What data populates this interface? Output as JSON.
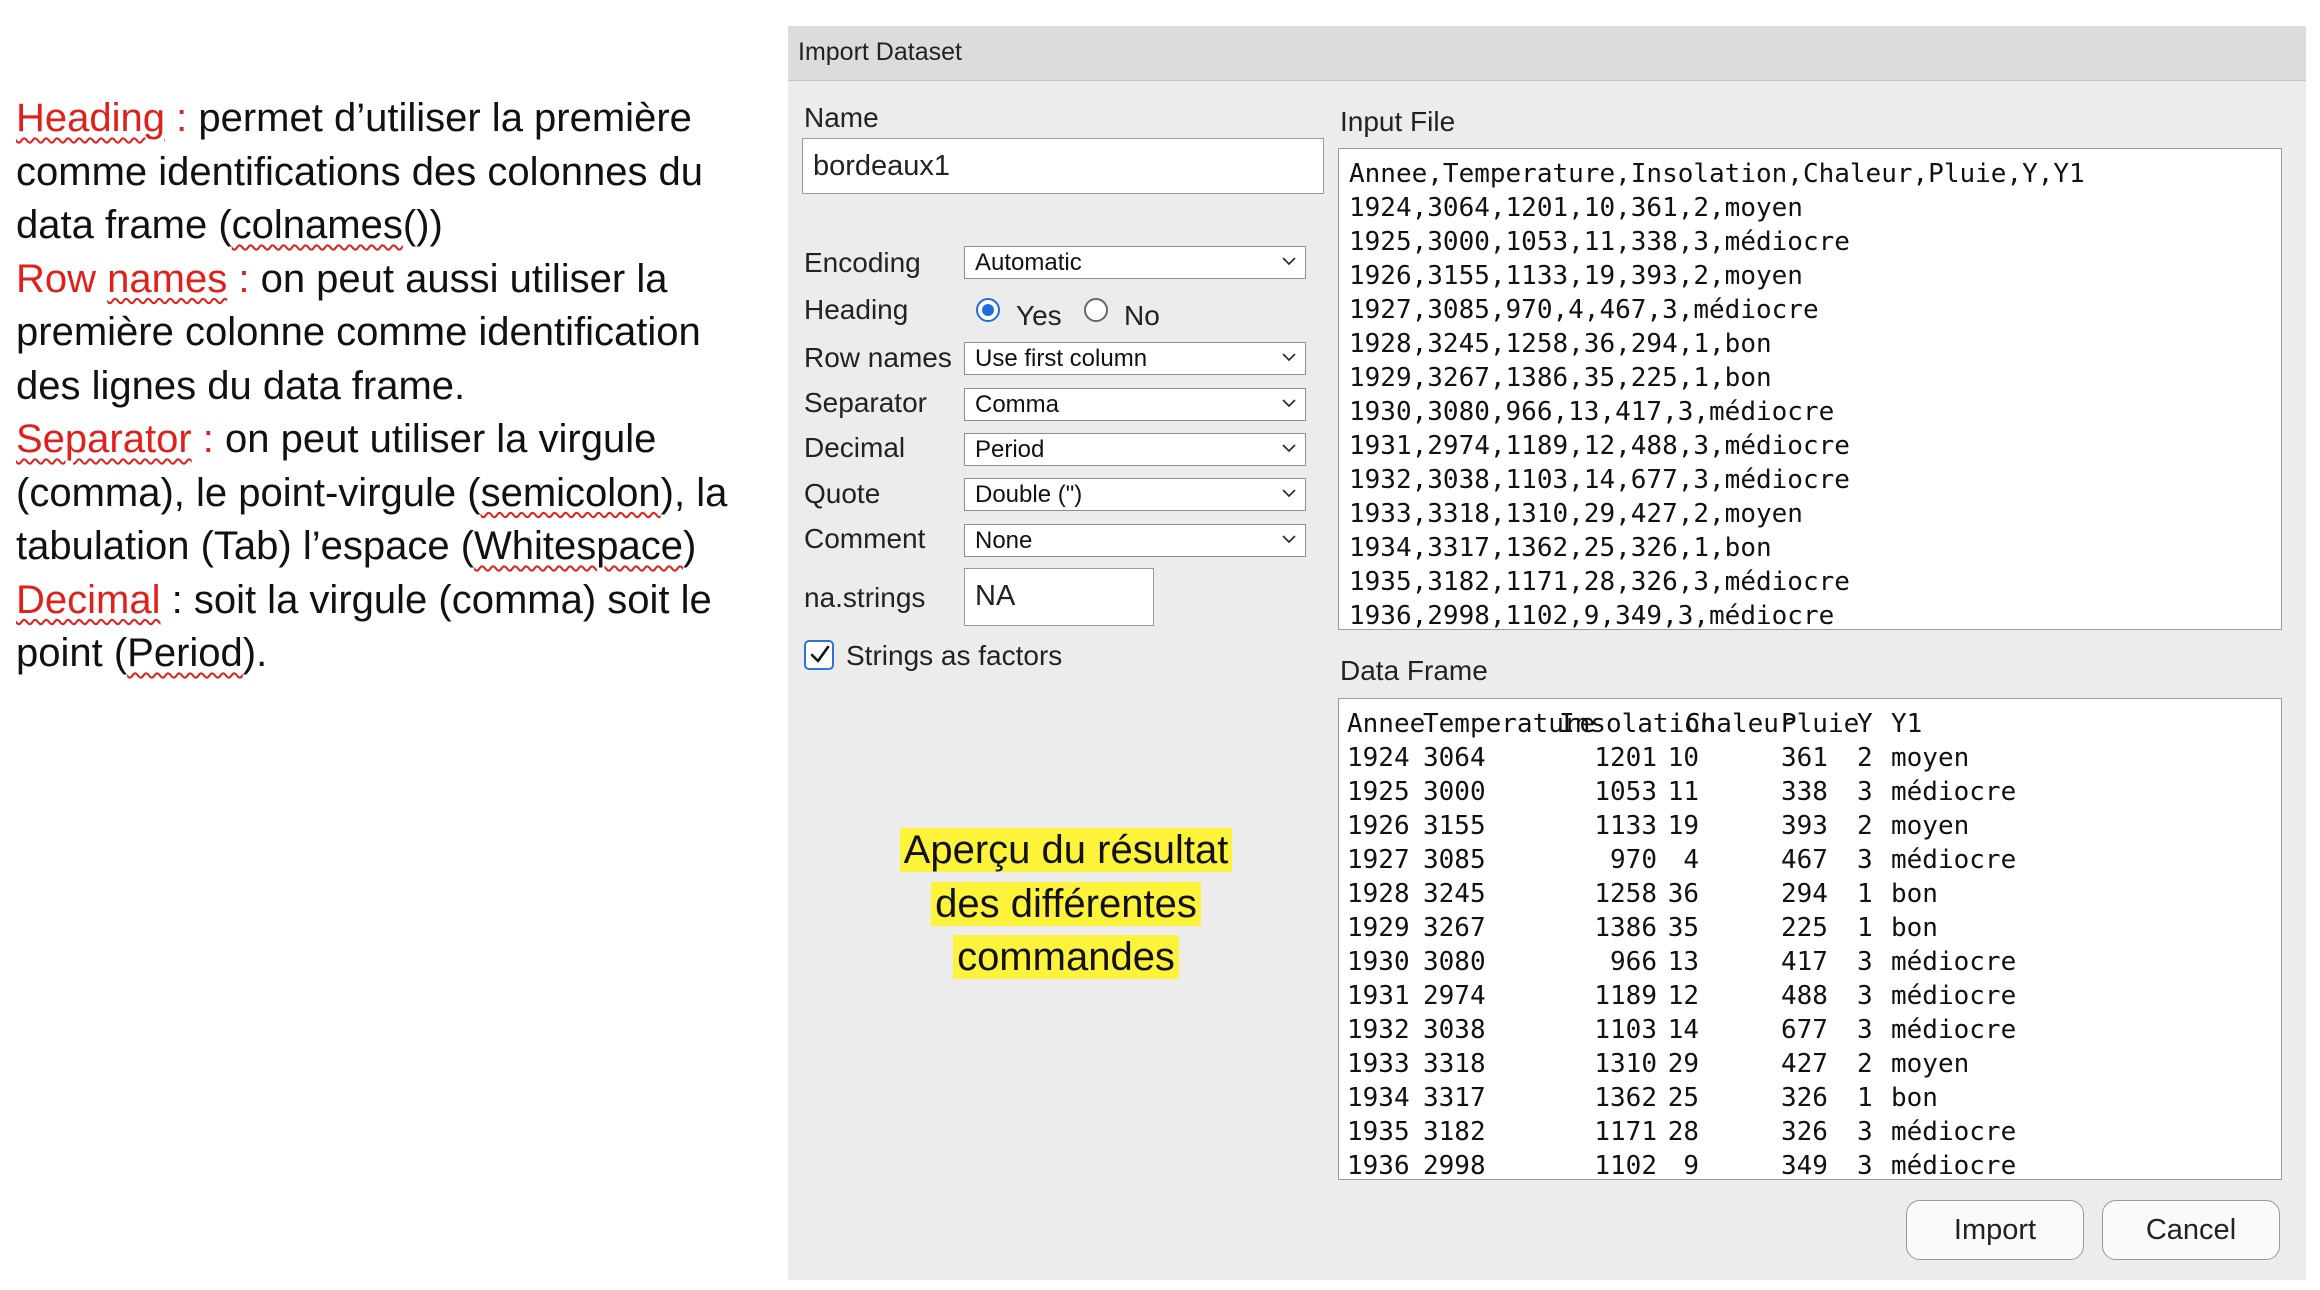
{
  "notes": {
    "p1": {
      "label": "Heading",
      "colon": " :",
      "text1": " permet d’utiliser la première comme identifications des colonnes du data frame (",
      "code": "colnames",
      "text2": "())"
    },
    "p2": {
      "label1": "Row",
      "label2": "names",
      "colon": " :",
      "text": " on peut aussi utiliser la première colonne comme identification des lignes du data frame."
    },
    "p3": {
      "label": "Separator",
      "colon": " :",
      "text1": " on peut utiliser la virgule (comma), le point-virgule (",
      "w1": "semicolon",
      "text2": "), la tabulation (Tab) l’espace (",
      "w2": "Whitespace",
      "text3": ")"
    },
    "p4": {
      "label": "Decimal",
      "text1": " : soit la virgule (comma) soit le point (",
      "w1": "Period",
      "text2": ")."
    }
  },
  "dialog": {
    "title": "Import Dataset",
    "name_label": "Name",
    "name_value": "bordeaux1",
    "encoding": {
      "label": "Encoding",
      "value": "Automatic"
    },
    "heading": {
      "label": "Heading",
      "yes": "Yes",
      "no": "No",
      "selected": "Yes"
    },
    "row_names": {
      "label": "Row names",
      "value": "Use first column"
    },
    "separator": {
      "label": "Separator",
      "value": "Comma"
    },
    "decimal": {
      "label": "Decimal",
      "value": "Period"
    },
    "quote": {
      "label": "Quote",
      "value": "Double (\")"
    },
    "comment": {
      "label": "Comment",
      "value": "None"
    },
    "na_strings": {
      "label": "na.strings",
      "value": "NA"
    },
    "strings_as_factors": {
      "label": "Strings as factors",
      "checked": true
    },
    "highlight": [
      "Aperçu du résultat",
      "des différentes",
      "commandes"
    ],
    "input_file": {
      "label": "Input File",
      "lines": [
        "Annee,Temperature,Insolation,Chaleur,Pluie,Y,Y1",
        "1924,3064,1201,10,361,2,moyen",
        "1925,3000,1053,11,338,3,médiocre",
        "1926,3155,1133,19,393,2,moyen",
        "1927,3085,970,4,467,3,médiocre",
        "1928,3245,1258,36,294,1,bon",
        "1929,3267,1386,35,225,1,bon",
        "1930,3080,966,13,417,3,médiocre",
        "1931,2974,1189,12,488,3,médiocre",
        "1932,3038,1103,14,677,3,médiocre",
        "1933,3318,1310,29,427,2,moyen",
        "1934,3317,1362,25,326,1,bon",
        "1935,3182,1171,28,326,3,médiocre",
        "1936,2998,1102,9,349,3,médiocre"
      ]
    },
    "data_frame": {
      "label": "Data Frame",
      "columns": [
        "Annee",
        "Temperature",
        "Insolation",
        "Chaleur",
        "Pluie",
        "Y",
        "Y1"
      ],
      "rows": [
        [
          "1924",
          "3064",
          "1201",
          "10",
          "361",
          "2",
          "moyen"
        ],
        [
          "1925",
          "3000",
          "1053",
          "11",
          "338",
          "3",
          "médiocre"
        ],
        [
          "1926",
          "3155",
          "1133",
          "19",
          "393",
          "2",
          "moyen"
        ],
        [
          "1927",
          "3085",
          "970",
          "4",
          "467",
          "3",
          "médiocre"
        ],
        [
          "1928",
          "3245",
          "1258",
          "36",
          "294",
          "1",
          "bon"
        ],
        [
          "1929",
          "3267",
          "1386",
          "35",
          "225",
          "1",
          "bon"
        ],
        [
          "1930",
          "3080",
          "966",
          "13",
          "417",
          "3",
          "médiocre"
        ],
        [
          "1931",
          "2974",
          "1189",
          "12",
          "488",
          "3",
          "médiocre"
        ],
        [
          "1932",
          "3038",
          "1103",
          "14",
          "677",
          "3",
          "médiocre"
        ],
        [
          "1933",
          "3318",
          "1310",
          "29",
          "427",
          "2",
          "moyen"
        ],
        [
          "1934",
          "3317",
          "1362",
          "25",
          "326",
          "1",
          "bon"
        ],
        [
          "1935",
          "3182",
          "1171",
          "28",
          "326",
          "3",
          "médiocre"
        ],
        [
          "1936",
          "2998",
          "1102",
          "9",
          "349",
          "3",
          "médiocre"
        ]
      ]
    },
    "buttons": {
      "import": "Import",
      "cancel": "Cancel"
    }
  },
  "colors": {
    "annotation_red": "#e0201b",
    "highlight_yellow": "#fcf33a",
    "radio_blue": "#1e6ce0"
  }
}
